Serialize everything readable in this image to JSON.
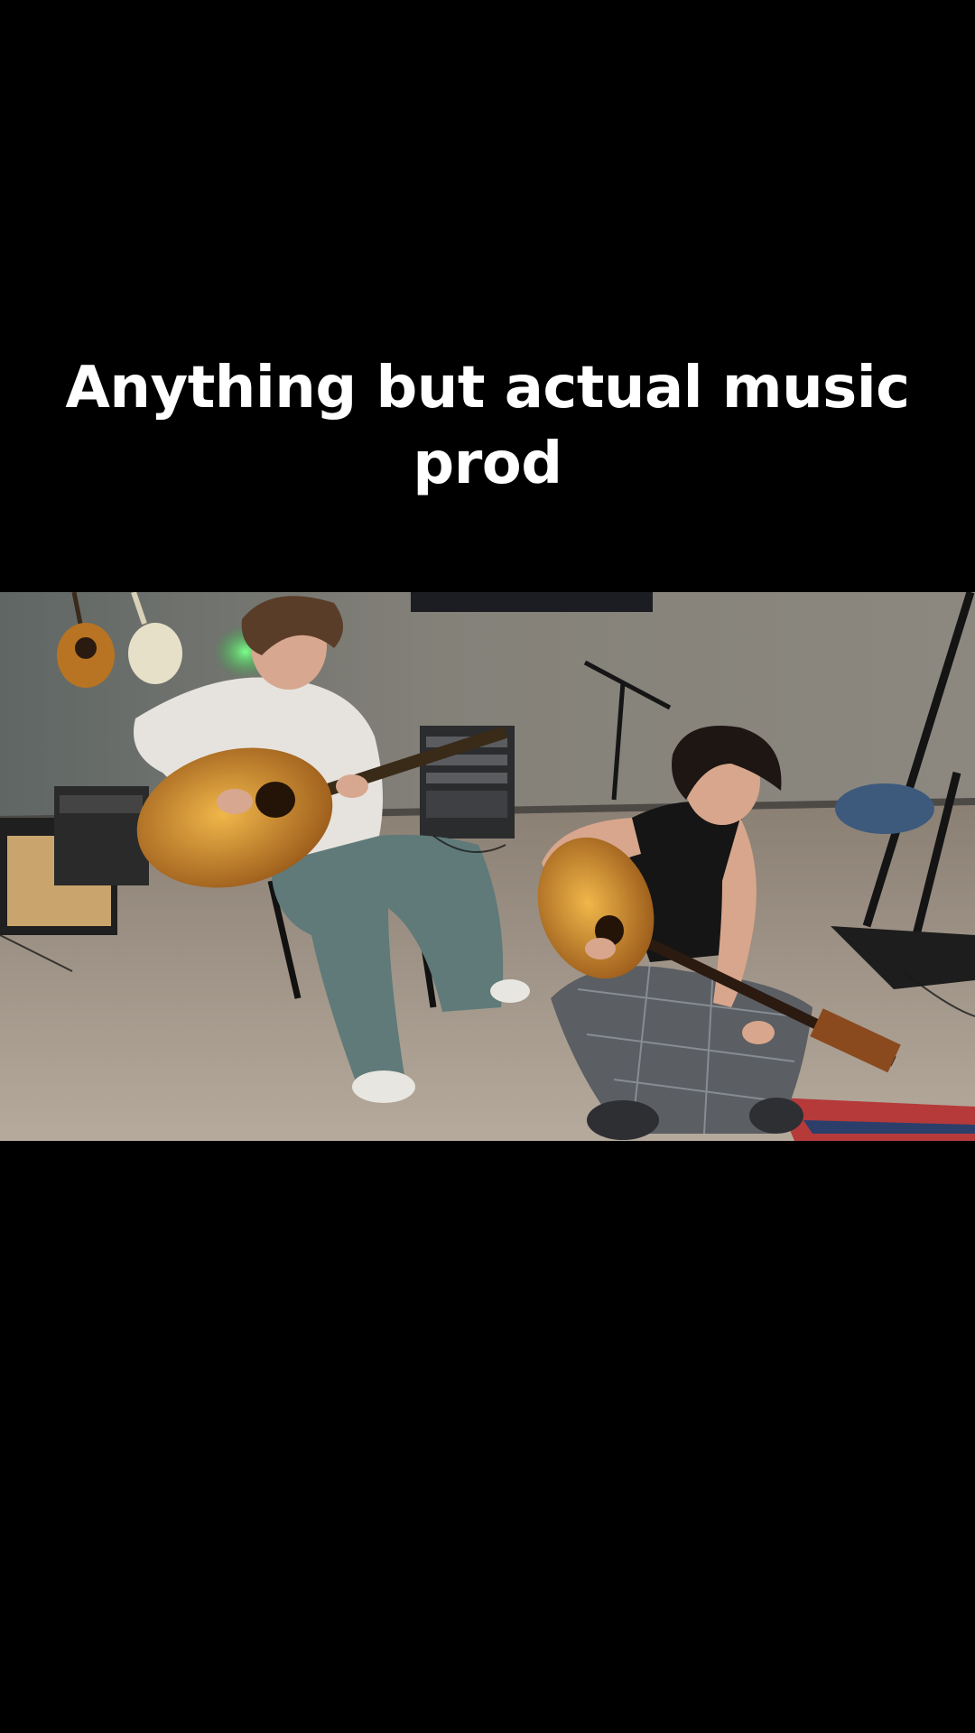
{
  "caption": {
    "line1": "Anything but actual music",
    "line2": "prod"
  },
  "video": {
    "description_icons": [
      "guitar-icon",
      "microphone-stand-icon",
      "amplifier-icon"
    ],
    "colors": {
      "wall": "#76746f",
      "floor": "#9c8f80",
      "guitar_body": "#d29a3a",
      "green_light": "#3dff6a",
      "background": "#000000"
    }
  }
}
